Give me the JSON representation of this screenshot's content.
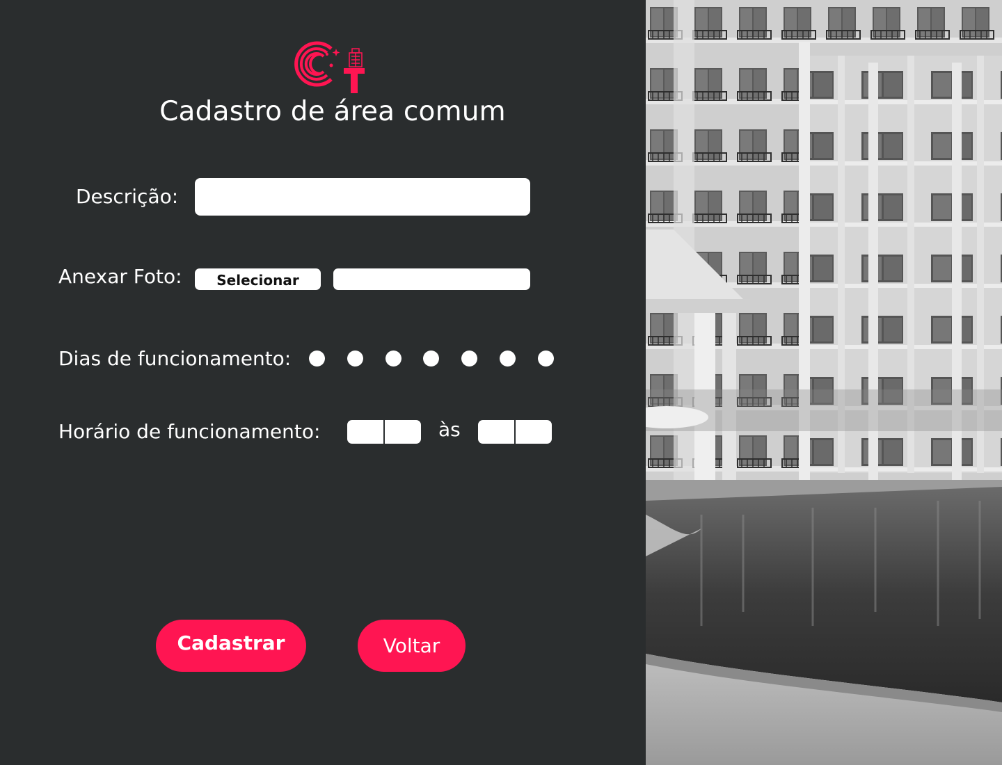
{
  "page": {
    "title": "Cadastro de área comum"
  },
  "form": {
    "descricao_label": "Descrição:",
    "descricao_value": "",
    "foto_label": "Anexar Foto:",
    "select_button": "Selecionar",
    "file_value": "",
    "dias_label": "Dias de funcionamento:",
    "days_count": 7,
    "horario_label": "Horário de funcionamento:",
    "as_label": "às",
    "start_hour": "",
    "start_minute": "",
    "end_hour": "",
    "end_minute": ""
  },
  "buttons": {
    "cadastrar": "Cadastrar",
    "voltar": "Voltar"
  },
  "icons": {
    "logo": "ct-building-logo-icon"
  },
  "colors": {
    "accent": "#ff1552",
    "background": "#2a2d2e",
    "input_bg": "#ffffff"
  }
}
